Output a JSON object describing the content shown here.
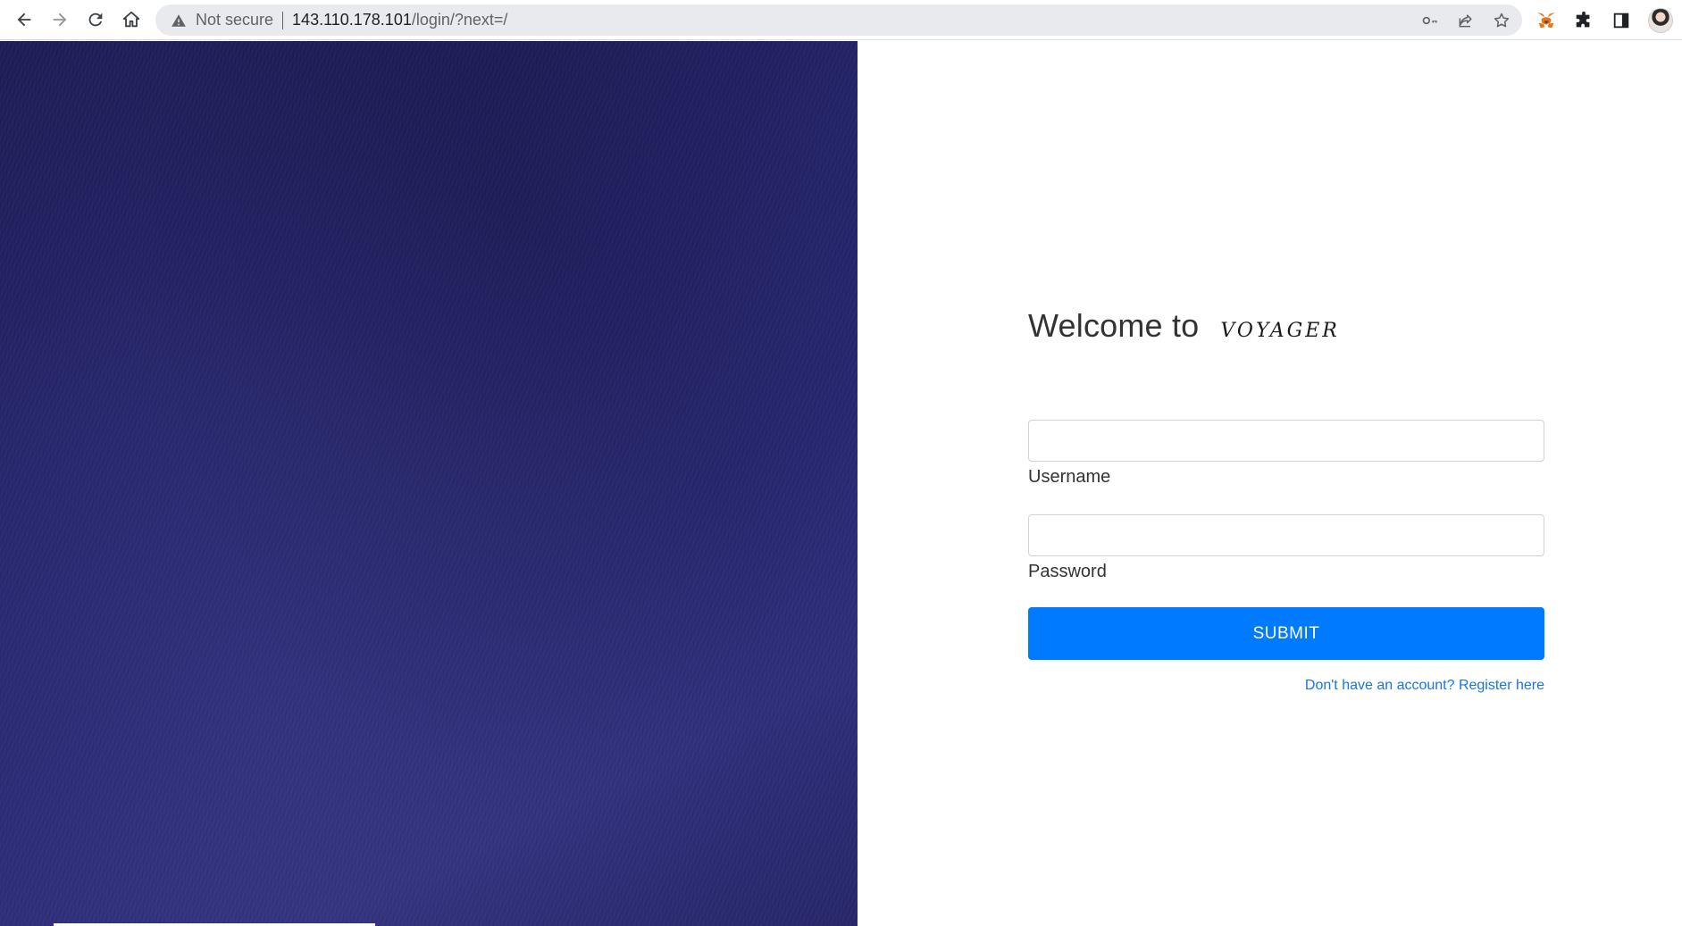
{
  "browser": {
    "security_label": "Not secure",
    "url_host": "143.110.178.101",
    "url_path": "/login/?next=/"
  },
  "login": {
    "welcome": "Welcome to",
    "brand": "VOYAGER",
    "username_label": "Username",
    "username_value": "",
    "password_label": "Password",
    "password_value": "",
    "submit_label": "SUBMIT",
    "register_link": "Don't have an account? Register here"
  },
  "colors": {
    "left_panel": "#23236b",
    "submit_button": "#007bff",
    "link": "#1a73e8"
  }
}
